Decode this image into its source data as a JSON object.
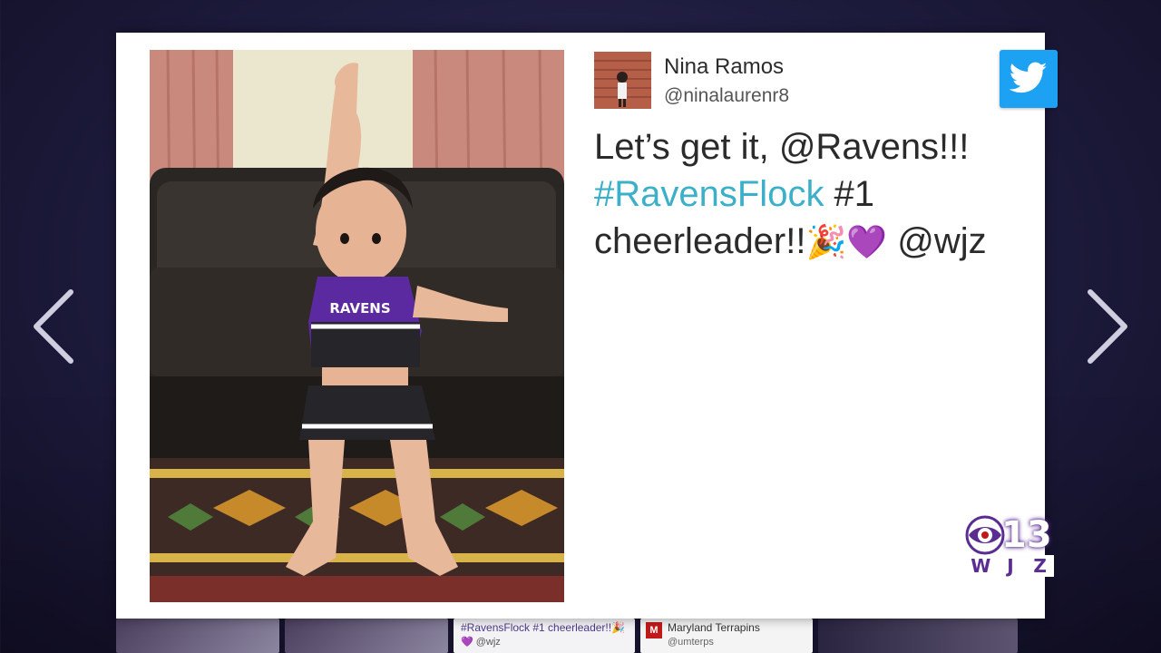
{
  "tweet": {
    "user_name": "Nina Ramos",
    "user_handle": "@ninalaurenr8",
    "text_line1": "Let’s get it, @Ravens!!!",
    "hashtag": "#RavensFlock",
    "text_after_hashtag": " #1",
    "text_line3": "cheerleader!!",
    "emoji_party": "🎉",
    "emoji_heart": "💜",
    "mention_end": " @wjz",
    "photo_jersey_text": "RAVENS"
  },
  "badge": {
    "icon": "twitter-bird-icon",
    "color": "#1da1f2"
  },
  "station_logo": {
    "number": "13",
    "letters": [
      "W",
      "J",
      "Z"
    ],
    "color": "#5a2d91"
  },
  "navigation": {
    "prev_icon": "chevron-left-icon",
    "next_icon": "chevron-right-icon"
  },
  "bottom_strip": {
    "tile1_text": "#RavensFlock #1 cheerleader!!🎉",
    "tile1_sub": "💜 @wjz",
    "tile2_badge": "M",
    "tile2_text": "Maryland Terrapins",
    "tile2_sub": "@umterps"
  },
  "colors": {
    "hashtag": "#3bb0c8",
    "background": "#1d1b3c"
  }
}
